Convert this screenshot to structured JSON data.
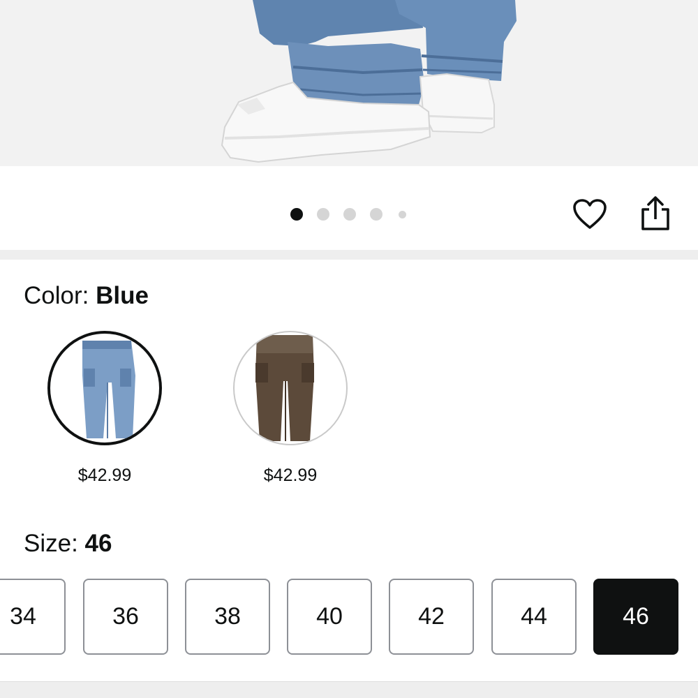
{
  "product_image": {
    "description_icon": "product-photo",
    "carousel": {
      "total": 5,
      "active_index": 0
    }
  },
  "actions": {
    "favorite_icon": "heart-icon",
    "share_icon": "share-icon"
  },
  "color": {
    "label": "Color:",
    "selected": "Blue",
    "options": [
      {
        "name": "blue",
        "price": "$42.99",
        "fill": "#6f93bd"
      },
      {
        "name": "brown",
        "price": "$42.99",
        "fill": "#5a4a3c"
      }
    ]
  },
  "size": {
    "label": "Size:",
    "selected": "46",
    "options": [
      "34",
      "36",
      "38",
      "40",
      "42",
      "44",
      "46"
    ]
  },
  "colors": {
    "accent_selected": "#0f1111",
    "dot_inactive": "#d5d5d5",
    "section_band": "#eeeeee"
  }
}
